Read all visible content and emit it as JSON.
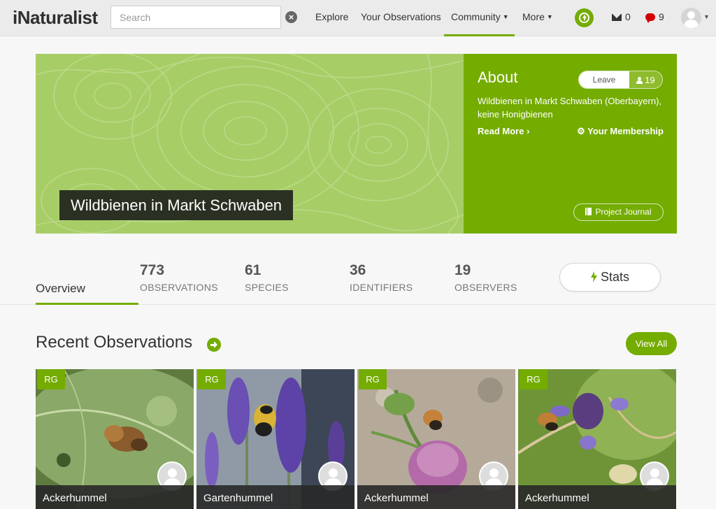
{
  "nav": {
    "logo": "iNaturalist",
    "search_placeholder": "Search",
    "links": {
      "explore": "Explore",
      "your_observations": "Your Observations",
      "community": "Community",
      "more": "More"
    },
    "messages_count": "0",
    "notifications_count": "9"
  },
  "project": {
    "title": "Wildbienen in Markt Schwaben",
    "about_heading": "About",
    "leave_label": "Leave",
    "members_count": "19",
    "description": "Wildbienen in Markt Schwaben (Oberbayern), keine Honigbienen",
    "read_more": "Read More",
    "your_membership": "Your Membership",
    "journal": "Project Journal"
  },
  "stats": {
    "overview_tab": "Overview",
    "observations": {
      "value": "773",
      "label": "OBSERVATIONS"
    },
    "species": {
      "value": "61",
      "label": "SPECIES"
    },
    "identifiers": {
      "value": "36",
      "label": "IDENTIFIERS"
    },
    "observers": {
      "value": "19",
      "label": "OBSERVERS"
    },
    "stats_button": "Stats"
  },
  "recent": {
    "title": "Recent Observations",
    "view_all": "View All",
    "items": [
      {
        "badge": "RG",
        "name": "Ackerhummel"
      },
      {
        "badge": "RG",
        "name": "Gartenhummel"
      },
      {
        "badge": "RG",
        "name": "Ackerhummel"
      },
      {
        "badge": "RG",
        "name": "Ackerhummel"
      }
    ]
  },
  "colors": {
    "brand_green": "#74ac00",
    "banner_green": "#a7cd67",
    "title_bg": "#2a3123"
  },
  "icons": [
    "search-clear-icon",
    "upload-icon",
    "envelope-icon",
    "chat-bubble-icon",
    "user-avatar-icon",
    "person-icon",
    "gear-icon",
    "book-icon",
    "bolt-icon",
    "arrow-right-icon"
  ]
}
